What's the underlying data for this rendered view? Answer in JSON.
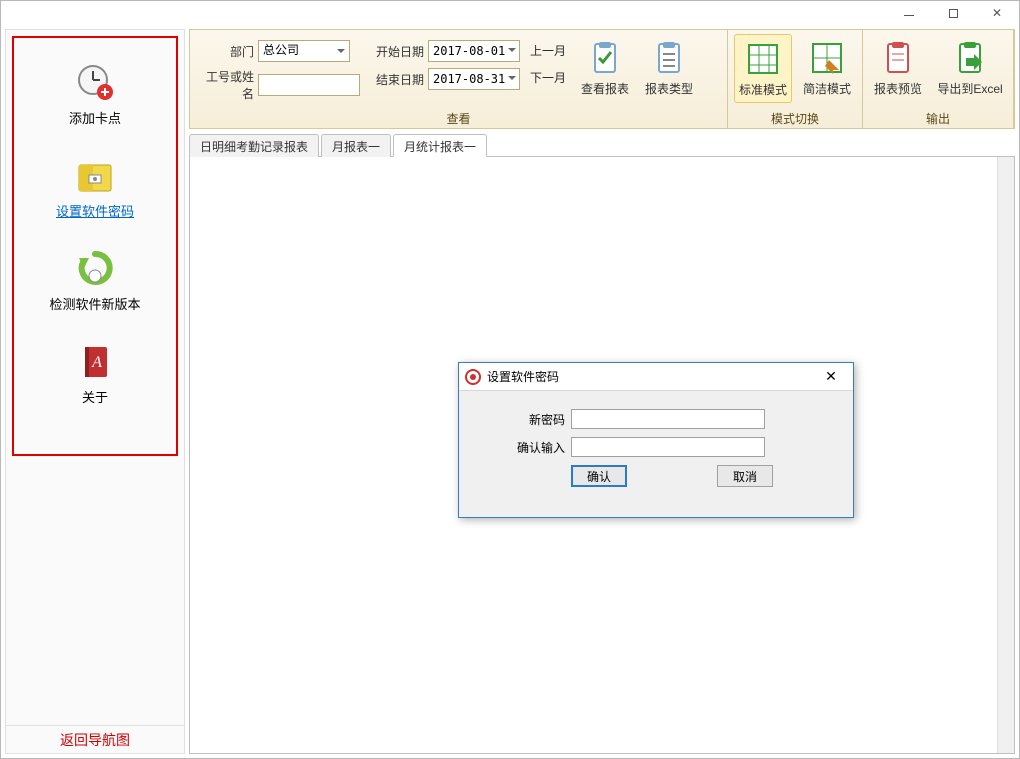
{
  "ribbon": {
    "dept_label": "部门",
    "dept_value": "总公司",
    "id_name_label": "工号或姓名",
    "id_name_value": "",
    "start_date_label": "开始日期",
    "start_date_value": "2017-08-01",
    "end_date_label": "结束日期",
    "end_date_value": "2017-08-31",
    "prev_month": "上一月",
    "next_month": "下一月",
    "view_report": "查看报表",
    "report_type": "报表类型",
    "group1_label": "查看",
    "standard_mode": "标准模式",
    "simple_mode": "简洁模式",
    "group2_label": "模式切换",
    "report_preview": "报表预览",
    "export_excel": "导出到Excel",
    "group3_label": "输出"
  },
  "sidebar": {
    "items": [
      {
        "label": "添加卡点"
      },
      {
        "label": "设置软件密码"
      },
      {
        "label": "检测软件新版本"
      },
      {
        "label": "关于"
      }
    ],
    "footer": "返回导航图"
  },
  "tabs": [
    {
      "label": "日明细考勤记录报表",
      "active": false
    },
    {
      "label": "月报表一",
      "active": false
    },
    {
      "label": "月统计报表一",
      "active": true
    }
  ],
  "dialog": {
    "title": "设置软件密码",
    "new_password_label": "新密码",
    "new_password_value": "",
    "confirm_label": "确认输入",
    "confirm_value": "",
    "ok": "确认",
    "cancel": "取消"
  }
}
